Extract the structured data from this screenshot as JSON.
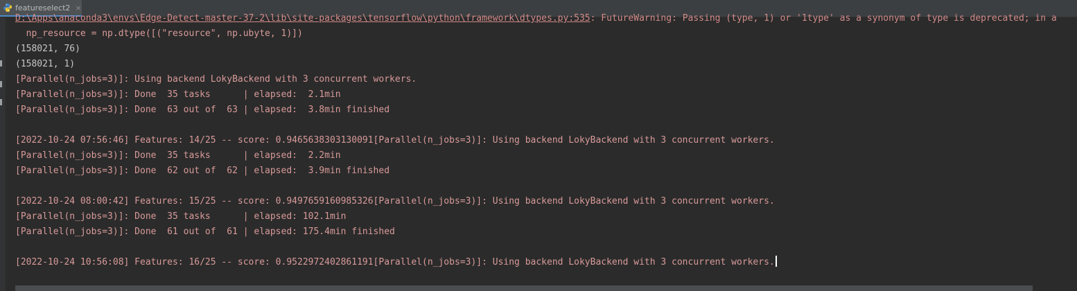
{
  "tab": {
    "label": "featureselect2",
    "close_glyph": "×",
    "icon": "python-icon"
  },
  "console": {
    "lines": [
      {
        "kind": "warn-path",
        "path": "D:\\Apps\\anaconda3\\envs\\Edge-Detect-master-37-2\\lib\\site-packages\\tensorflow\\python\\framework\\dtypes.py:535",
        "text": ": FutureWarning: Passing (type, 1) or '1type' as a synonym of type is deprecated; in a"
      },
      {
        "kind": "red",
        "text": "  np_resource = np.dtype([(\"resource\", np.ubyte, 1)])"
      },
      {
        "kind": "plain",
        "text": "(158021, 76)"
      },
      {
        "kind": "plain",
        "text": "(158021, 1)"
      },
      {
        "kind": "red",
        "text": "[Parallel(n_jobs=3)]: Using backend LokyBackend with 3 concurrent workers."
      },
      {
        "kind": "red",
        "text": "[Parallel(n_jobs=3)]: Done  35 tasks      | elapsed:  2.1min"
      },
      {
        "kind": "red",
        "text": "[Parallel(n_jobs=3)]: Done  63 out of  63 | elapsed:  3.8min finished"
      },
      {
        "kind": "plain",
        "text": ""
      },
      {
        "kind": "red",
        "text": "[2022-10-24 07:56:46] Features: 14/25 -- score: 0.9465638303130091[Parallel(n_jobs=3)]: Using backend LokyBackend with 3 concurrent workers."
      },
      {
        "kind": "red",
        "text": "[Parallel(n_jobs=3)]: Done  35 tasks      | elapsed:  2.2min"
      },
      {
        "kind": "red",
        "text": "[Parallel(n_jobs=3)]: Done  62 out of  62 | elapsed:  3.9min finished"
      },
      {
        "kind": "plain",
        "text": ""
      },
      {
        "kind": "red",
        "text": "[2022-10-24 08:00:42] Features: 15/25 -- score: 0.9497659160985326[Parallel(n_jobs=3)]: Using backend LokyBackend with 3 concurrent workers."
      },
      {
        "kind": "red",
        "text": "[Parallel(n_jobs=3)]: Done  35 tasks      | elapsed: 102.1min"
      },
      {
        "kind": "red",
        "text": "[Parallel(n_jobs=3)]: Done  61 out of  61 | elapsed: 175.4min finished"
      },
      {
        "kind": "plain",
        "text": ""
      },
      {
        "kind": "red",
        "text": "[2022-10-24 10:56:08] Features: 16/25 -- score: 0.9522972402861191[Parallel(n_jobs=3)]: Using backend LokyBackend with 3 concurrent workers.",
        "caret": true
      }
    ]
  },
  "colors": {
    "background": "#2b2b2b",
    "text": "#c7c7c7",
    "stderr": "#d99a9a",
    "tab_accent": "#4a88c7"
  }
}
